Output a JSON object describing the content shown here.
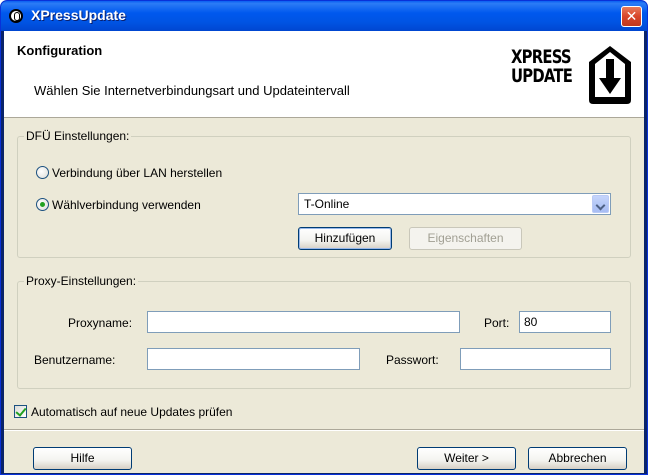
{
  "window": {
    "title": "XPressUpdate",
    "close_label": "✕"
  },
  "header": {
    "title": "Konfiguration",
    "subtitle": "Wählen Sie Internetverbindungsart und Updateintervall",
    "logo_line1": "XPRESS",
    "logo_line2": "UPDATE"
  },
  "dfu": {
    "legend": "DFÜ Einstellungen:",
    "lan_label": "Verbindung über LAN herstellen",
    "dial_label": "Wählverbindung verwenden",
    "selected_mode": "dial",
    "connection_value": "T-Online",
    "add_button": "Hinzufügen",
    "properties_button": "Eigenschaften"
  },
  "proxy": {
    "legend": "Proxy-Einstellungen:",
    "name_label": "Proxyname:",
    "name_value": "",
    "port_label": "Port:",
    "port_value": "80",
    "user_label": "Benutzername:",
    "user_value": "",
    "password_label": "Passwort:",
    "password_value": ""
  },
  "auto_update": {
    "label": "Automatisch auf neue Updates prüfen",
    "checked": true
  },
  "footer": {
    "help_button": "Hilfe",
    "next_button": "Weiter >",
    "cancel_button": "Abbrechen"
  },
  "colors": {
    "titlebar": "#0054e3",
    "dialog_bg": "#ece9d8",
    "radio_dot": "#21a121"
  }
}
